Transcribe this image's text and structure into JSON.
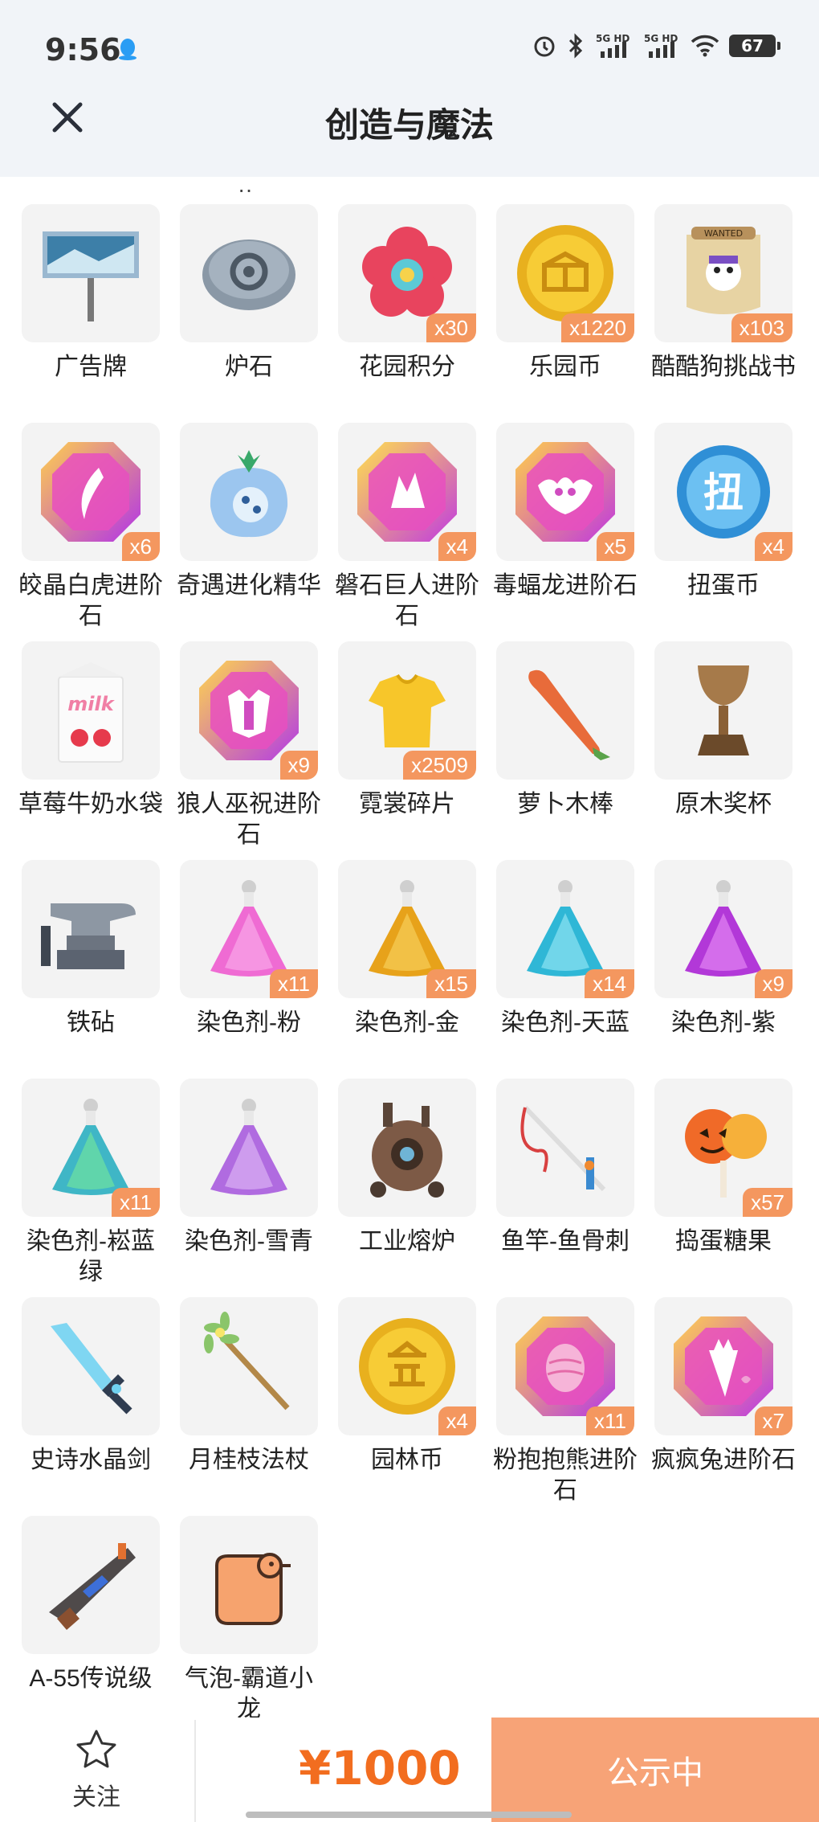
{
  "status_bar": {
    "time": "9:56",
    "network1": "5G HD",
    "network2": "5G HD",
    "battery": "67"
  },
  "header": {
    "title": "创造与魔法"
  },
  "top_clip_fragment": "··",
  "items": [
    {
      "name": "广告牌",
      "count": null,
      "icon": "billboard-icon"
    },
    {
      "name": "炉石",
      "count": null,
      "icon": "hearthstone-icon"
    },
    {
      "name": "花园积分",
      "count": "x30",
      "icon": "flower-token-icon"
    },
    {
      "name": "乐园币",
      "count": "x1220",
      "icon": "gold-coin-icon"
    },
    {
      "name": "酷酷狗挑战书",
      "count": "x103",
      "icon": "wanted-scroll-icon"
    },
    {
      "name": "皎晶白虎进阶石",
      "count": "x6",
      "icon": "gem-claw-icon"
    },
    {
      "name": "奇遇进化精华",
      "count": null,
      "icon": "crystal-fruit-icon"
    },
    {
      "name": "磐石巨人进阶石",
      "count": "x4",
      "icon": "gem-rock-icon"
    },
    {
      "name": "毒蝠龙进阶石",
      "count": "x5",
      "icon": "gem-bat-icon"
    },
    {
      "name": "扭蛋币",
      "count": "x4",
      "icon": "gacha-coin-icon"
    },
    {
      "name": "草莓牛奶水袋",
      "count": null,
      "icon": "milk-carton-icon"
    },
    {
      "name": "狼人巫祝进阶石",
      "count": "x9",
      "icon": "gem-wolf-icon"
    },
    {
      "name": "霓裳碎片",
      "count": "x2509",
      "icon": "shirt-shard-icon"
    },
    {
      "name": "萝卜木棒",
      "count": null,
      "icon": "carrot-stick-icon"
    },
    {
      "name": "原木奖杯",
      "count": null,
      "icon": "wooden-trophy-icon"
    },
    {
      "name": "铁砧",
      "count": null,
      "icon": "anvil-icon"
    },
    {
      "name": "染色剂-粉",
      "count": "x11",
      "icon": "dye-pink-icon"
    },
    {
      "name": "染色剂-金",
      "count": "x15",
      "icon": "dye-gold-icon"
    },
    {
      "name": "染色剂-天蓝",
      "count": "x14",
      "icon": "dye-skyblue-icon"
    },
    {
      "name": "染色剂-紫",
      "count": "x9",
      "icon": "dye-purple-icon"
    },
    {
      "name": "染色剂-崧蓝绿",
      "count": "x11",
      "icon": "dye-teal-icon"
    },
    {
      "name": "染色剂-雪青",
      "count": null,
      "icon": "dye-lilac-icon"
    },
    {
      "name": "工业熔炉",
      "count": null,
      "icon": "industrial-furnace-icon"
    },
    {
      "name": "鱼竿-鱼骨刺",
      "count": null,
      "icon": "fishing-rod-icon"
    },
    {
      "name": "捣蛋糖果",
      "count": "x57",
      "icon": "pumpkin-candy-icon"
    },
    {
      "name": "史诗水晶剑",
      "count": null,
      "icon": "crystal-sword-icon"
    },
    {
      "name": "月桂枝法杖",
      "count": null,
      "icon": "laurel-staff-icon"
    },
    {
      "name": "园林币",
      "count": "x4",
      "icon": "garden-coin-icon"
    },
    {
      "name": "粉抱抱熊进阶石",
      "count": "x11",
      "icon": "gem-egg-icon"
    },
    {
      "name": "疯疯兔进阶石",
      "count": "x7",
      "icon": "gem-carrot-icon"
    },
    {
      "name": "A-55传说级",
      "count": null,
      "icon": "legendary-gun-icon"
    },
    {
      "name": "气泡-霸道小龙",
      "count": null,
      "icon": "bubble-dragon-icon"
    }
  ],
  "bottom": {
    "follow_label": "关注",
    "price": "¥1000",
    "status_label": "公示中"
  },
  "colors": {
    "accent": "#f26d1f",
    "badge": "#f4975f",
    "button": "#f7a377",
    "tile": "#f3f3f3"
  }
}
